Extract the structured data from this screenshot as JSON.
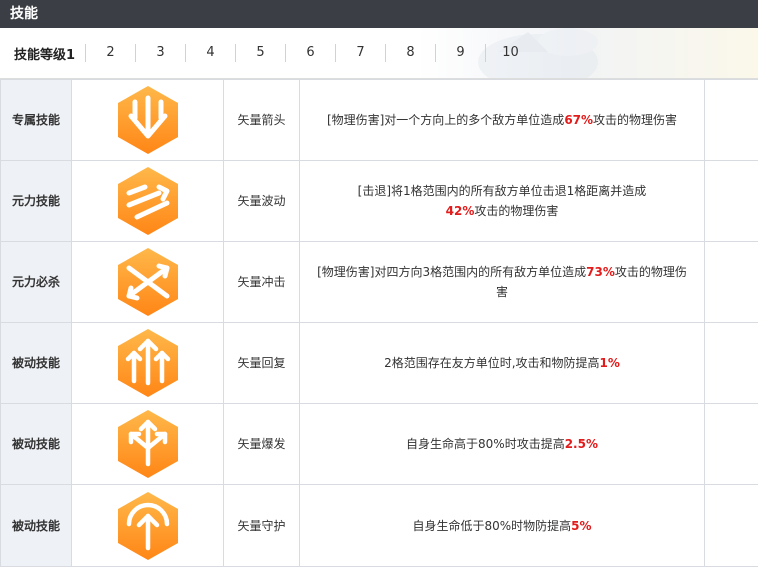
{
  "header": {
    "title": "技能"
  },
  "levels": {
    "label": "技能等级1",
    "items": [
      "2",
      "3",
      "4",
      "5",
      "6",
      "7",
      "8",
      "9",
      "10"
    ]
  },
  "colors": {
    "icon_top": "#ffb43a",
    "icon_bottom": "#ff8a1a",
    "highlight": "#e21b1b"
  },
  "skills": [
    {
      "category": "专属技能",
      "icon": "vector-arrow-down-icon",
      "name": "矢量箭头",
      "pre": "[物理伤害]对一个方向上的多个敌方单位造成",
      "value": "67%",
      "post": "攻击的物理伤害"
    },
    {
      "category": "元力技能",
      "icon": "vector-wave-icon",
      "name": "矢量波动",
      "pre": "[击退]将1格范围内的所有敌方单位击退1格距离并造成",
      "value": "42%",
      "post": "攻击的物理伤害"
    },
    {
      "category": "元力必杀",
      "icon": "vector-cross-icon",
      "name": "矢量冲击",
      "pre": "[物理伤害]对四方向3格范围内的所有敌方单位造成",
      "value": "73%",
      "post": "攻击的物理伤害"
    },
    {
      "category": "被动技能",
      "icon": "vector-triple-arrow-up-icon",
      "name": "矢量回复",
      "pre": "2格范围存在友方单位时,攻击和物防提高",
      "value": "1%",
      "post": ""
    },
    {
      "category": "被动技能",
      "icon": "vector-burst-icon",
      "name": "矢量爆发",
      "pre": "自身生命高于80%时攻击提高",
      "value": "2.5%",
      "post": ""
    },
    {
      "category": "被动技能",
      "icon": "vector-guard-icon",
      "name": "矢量守护",
      "pre": "自身生命低于80%时物防提高",
      "value": "5%",
      "post": ""
    }
  ]
}
